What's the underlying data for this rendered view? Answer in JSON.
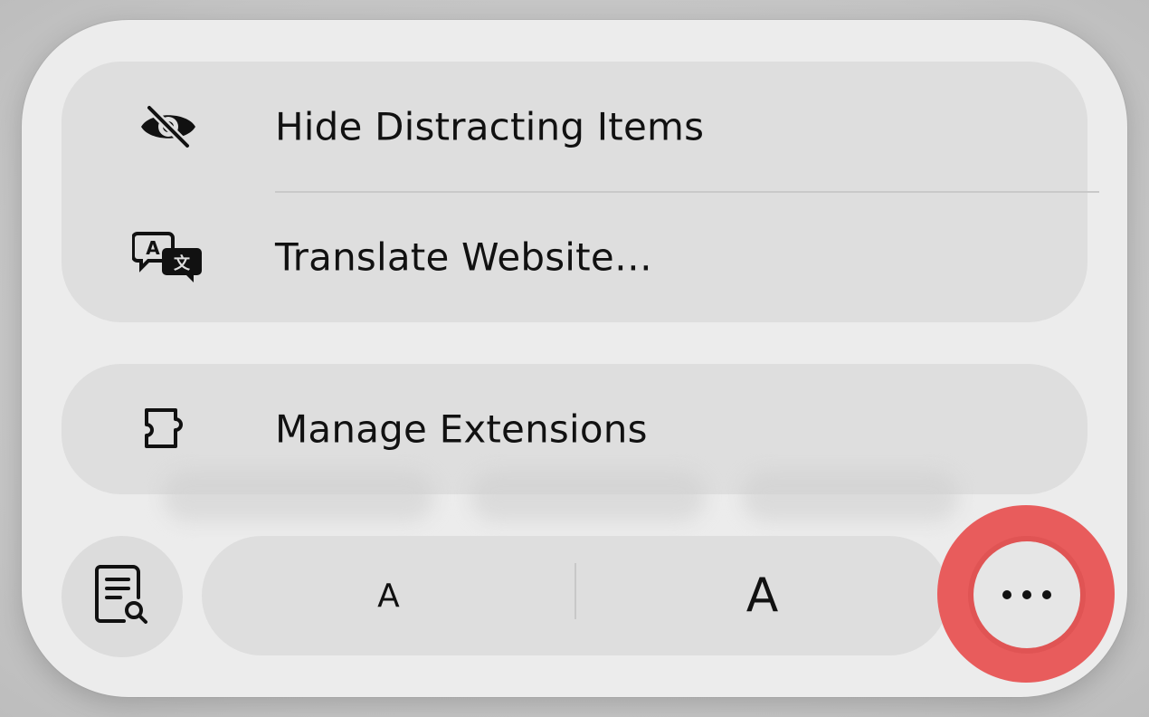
{
  "menu": {
    "items": [
      {
        "label": "Hide Distracting Items",
        "icon": "eye-slash-icon"
      },
      {
        "label": "Translate Website…",
        "icon": "translate-icon"
      },
      {
        "label": "Manage Extensions",
        "icon": "puzzle-extension-icon"
      }
    ]
  },
  "toolbar": {
    "reader_icon": "reader-document-search-icon",
    "font_smaller_label": "A",
    "font_larger_label": "A",
    "more_icon": "ellipsis-icon"
  },
  "colors": {
    "panel": "#ececec",
    "group": "#dedede",
    "highlight": "#e85c5c"
  }
}
